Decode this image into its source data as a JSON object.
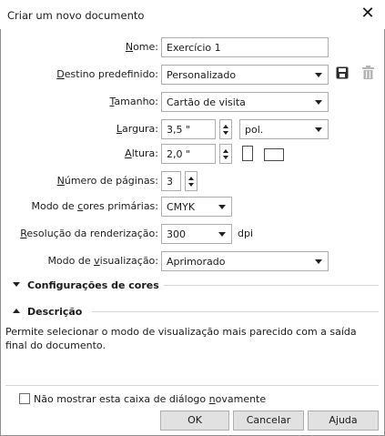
{
  "window": {
    "title": "Criar um novo documento"
  },
  "form": {
    "name": {
      "label_pre": "",
      "label_u": "N",
      "label_post": "ome:",
      "value": "Exercício 1"
    },
    "preset": {
      "label_pre": "",
      "label_u": "D",
      "label_post": "estino predefinido:",
      "value": "Personalizado"
    },
    "size": {
      "label_pre": "",
      "label_u": "T",
      "label_post": "amanho:",
      "value": "Cartão de visita"
    },
    "width": {
      "label_pre": "",
      "label_u": "L",
      "label_post": "argura:",
      "value": "3,5 \"",
      "unit": "pol."
    },
    "height": {
      "label_pre": "",
      "label_u": "A",
      "label_post": "ltura:",
      "value": "2,0 \""
    },
    "pages": {
      "label_pre": "",
      "label_u": "N",
      "label_post": "úmero de páginas:",
      "value": "3"
    },
    "color_mode": {
      "label_pre": "Modo de ",
      "label_u": "c",
      "label_post": "ores primárias:",
      "value": "CMYK"
    },
    "resolution": {
      "label_pre": "",
      "label_u": "R",
      "label_post": "esolução da renderização:",
      "value": "300",
      "unit": "dpi"
    },
    "view_mode": {
      "label_pre": "Modo de ",
      "label_u": "v",
      "label_post": "isualização:",
      "value": "Aprimorado"
    }
  },
  "sections": {
    "color_settings": "Configurações de cores",
    "description": "Descrição",
    "description_text": "Permite selecionar o modo de visualização mais parecido com a saída final do documento."
  },
  "footer": {
    "dont_show_pre": "Não mostrar esta caixa de diálogo ",
    "dont_show_u": "n",
    "dont_show_post": "ovamente",
    "ok": "OK",
    "cancel": "Cancelar",
    "help": "Ajuda"
  },
  "icons": {
    "save": "save-preset-icon",
    "delete": "delete-preset-icon",
    "close": "close-icon",
    "portrait": "portrait-icon",
    "landscape": "landscape-icon"
  }
}
